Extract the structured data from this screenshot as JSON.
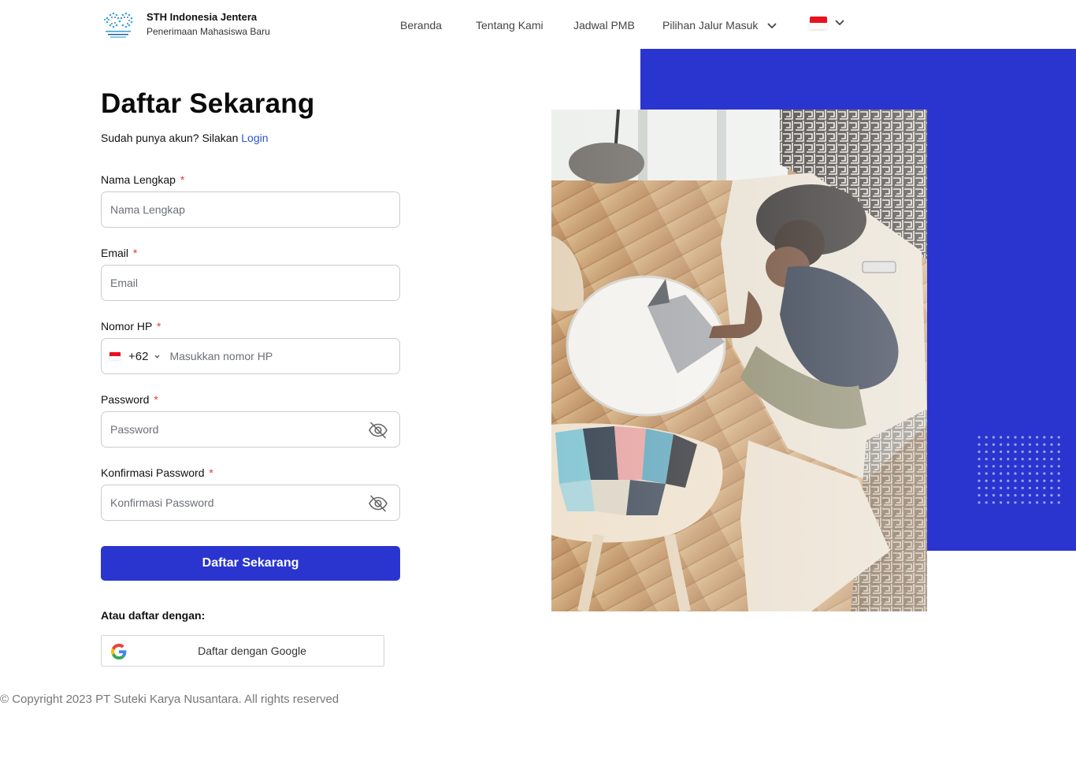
{
  "header": {
    "brand_name": "STH Indonesia Jentera",
    "brand_subtitle": "Penerimaan Mahasiswa Baru",
    "nav": [
      {
        "label": "Beranda"
      },
      {
        "label": "Tentang Kami"
      },
      {
        "label": "Jadwal PMB"
      },
      {
        "label": "Pilihan Jalur Masuk",
        "icon": "chevron-down-icon"
      }
    ],
    "language_flag": "indonesia-flag-icon"
  },
  "form": {
    "title": "Daftar Sekarang",
    "login_prompt": "Sudah punya akun? Silakan",
    "login_link": "Login",
    "required_mark": "*",
    "fields": {
      "full_name": {
        "label": "Nama Lengkap",
        "placeholder": "Nama Lengkap",
        "value": ""
      },
      "email": {
        "label": "Email",
        "placeholder": "Email",
        "value": ""
      },
      "phone": {
        "label": "Nomor HP",
        "country_code": "+62",
        "placeholder": "Masukkan nomor HP",
        "value": ""
      },
      "password": {
        "label": "Password",
        "placeholder": "Password",
        "value": "",
        "icon": "eye-off-icon"
      },
      "confirm_password": {
        "label": "Konfirmasi Password",
        "placeholder": "Konfirmasi Password",
        "value": "",
        "icon": "eye-off-icon"
      }
    },
    "submit_label": "Daftar Sekarang",
    "alt_label": "Atau daftar dengan:",
    "google_label": "Daftar dengan Google"
  },
  "footer": {
    "copyright": "© Copyright 2023 PT Suteki Karya Nusantara. All rights reserved"
  },
  "colors": {
    "primary": "#2a35cf",
    "link": "#2a55d8",
    "required": "#e53935"
  }
}
